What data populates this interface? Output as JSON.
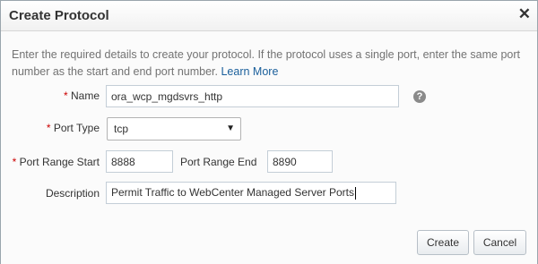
{
  "dialog": {
    "title": "Create Protocol",
    "close_glyph": "✕"
  },
  "intro": {
    "text": "Enter the required details to create your protocol. If the protocol uses a single port, enter the same port number as the start and end port number. ",
    "link": "Learn More"
  },
  "form": {
    "required_marker": "*",
    "name": {
      "label": "Name",
      "value": "ora_wcp_mgdsvrs_http"
    },
    "help_glyph": "?",
    "port_type": {
      "label": "Port Type",
      "value": "tcp",
      "arrow": "▼"
    },
    "port_range_start": {
      "label": "Port Range Start",
      "value": "8888"
    },
    "port_range_end": {
      "label": "Port Range End",
      "value": "8890"
    },
    "description": {
      "label": "Description",
      "value": "Permit Traffic to WebCenter Managed Server Ports"
    }
  },
  "buttons": {
    "create": "Create",
    "cancel": "Cancel"
  },
  "icons": {
    "close": "close-icon",
    "help": "help-icon",
    "dropdown": "chevron-down-icon"
  },
  "colors": {
    "link": "#1a5f9b",
    "required": "#cc0000",
    "help_icon": "#8a8a8a"
  }
}
